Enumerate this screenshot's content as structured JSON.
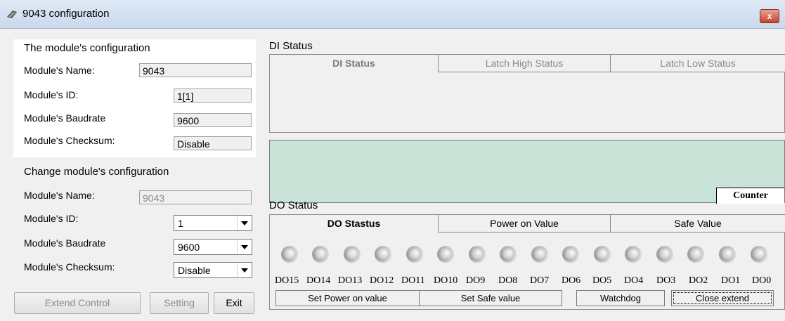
{
  "window": {
    "title": "9043 configuration",
    "close_glyph": "x"
  },
  "module_config": {
    "header": "The module's configuration",
    "rows": [
      {
        "label": "Module's Name:",
        "value": "9043"
      },
      {
        "label": "Module's  ID:",
        "value": "1[1]"
      },
      {
        "label": "Module's Baudrate",
        "value": "9600"
      },
      {
        "label": "Module's Checksum:",
        "value": "Disable"
      }
    ]
  },
  "change_config": {
    "header": "Change module's configuration",
    "name_label": "Module's Name:",
    "name_value": "9043",
    "id_label": "Module's  ID:",
    "id_value": "1",
    "baud_label": "Module's Baudrate",
    "baud_value": "9600",
    "checksum_label": "Module's Checksum:",
    "checksum_value": "Disable"
  },
  "buttons": {
    "extend_control": "Extend Control",
    "setting": "Setting",
    "exit": "Exit"
  },
  "di_status": {
    "section_label": "DI Status",
    "tabs": [
      "DI Status",
      "Latch High Status",
      "Latch Low Status"
    ]
  },
  "counter_label": "Counter",
  "do_status": {
    "section_label": "DO Status",
    "tabs": [
      "DO Stastus",
      "Power on Value",
      "Safe Value"
    ],
    "channels": [
      "DO15",
      "DO14",
      "DO13",
      "DO12",
      "DO11",
      "DO10",
      "DO9",
      "DO8",
      "DO7",
      "DO6",
      "DO5",
      "DO4",
      "DO3",
      "DO2",
      "DO1",
      "DO0"
    ]
  },
  "bottom_buttons": {
    "set_power_on": "Set Power on value",
    "set_safe": "Set Safe value",
    "watchdog": "Watchdog",
    "close_extend": "Close extend"
  }
}
